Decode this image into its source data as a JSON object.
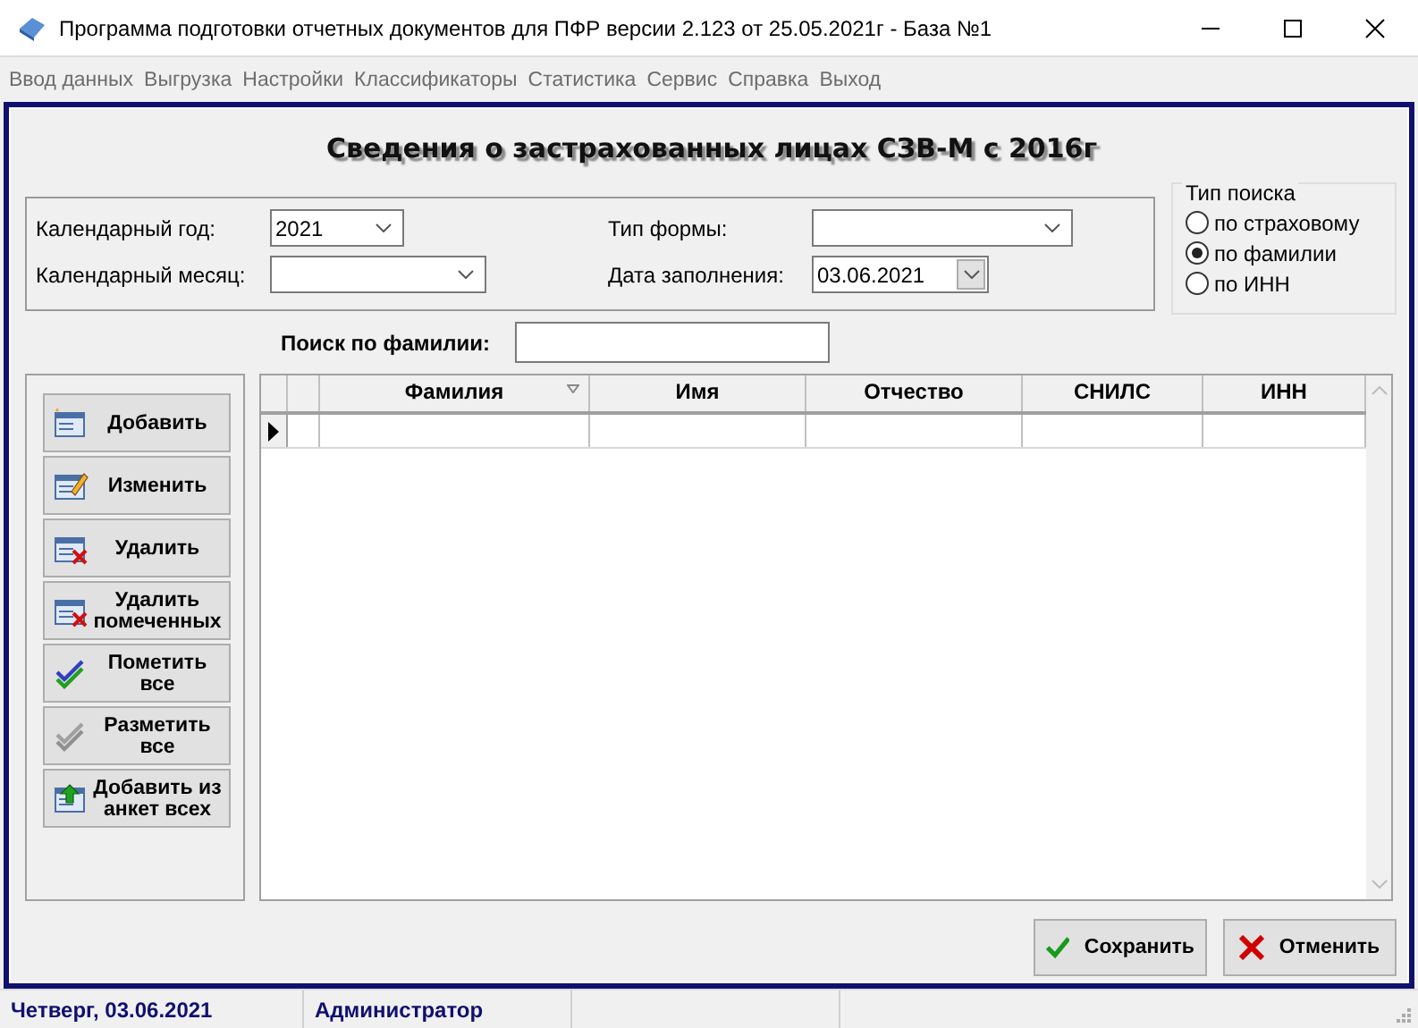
{
  "window": {
    "title": "Программа подготовки отчетных документов для ПФР версии 2.123 от 25.05.2021г - База №1"
  },
  "menu": [
    {
      "label": "Ввод данных",
      "disabled": true
    },
    {
      "label": "Выгрузка",
      "disabled": true
    },
    {
      "label": "Настройки",
      "disabled": true
    },
    {
      "label": "Классификаторы",
      "disabled": true
    },
    {
      "label": "Статистика",
      "disabled": true
    },
    {
      "label": "Сервис",
      "disabled": true
    },
    {
      "label": "Справка",
      "disabled": true
    },
    {
      "label": "Выход",
      "disabled": true
    }
  ],
  "form": {
    "title": "Сведения о застрахованных лицах СЗВ-М с 2016г",
    "fields": [
      {
        "label": "Календарный год:",
        "value": "2021",
        "kind": "combo"
      },
      {
        "label": "Календарный месяц:",
        "kind": "combo"
      },
      {
        "label": "Тип формы:",
        "kind": "combo"
      },
      {
        "label": "Дата заполнения:",
        "value": "03.06.2021",
        "kind": "date"
      }
    ],
    "search_type": {
      "title": "Тип поиска",
      "options": [
        {
          "label": "по страховому",
          "selected": false
        },
        {
          "label": "по фамилии",
          "selected": true
        },
        {
          "label": "по ИНН",
          "selected": false
        }
      ]
    },
    "search": {
      "label": "Поиск по фамилии:"
    },
    "side_buttons": [
      {
        "label": "Добавить",
        "kind": "add"
      },
      {
        "label": "Изменить",
        "kind": "edit"
      },
      {
        "label": "Удалить",
        "kind": "delete"
      },
      {
        "label": "Удалить помеченных",
        "kind": "delete"
      },
      {
        "label": "Пометить все",
        "kind": "mark"
      },
      {
        "label": "Разметить все",
        "kind": "unmark"
      },
      {
        "label": "Добавить из анкет всех",
        "kind": "import"
      }
    ],
    "table": {
      "columns": [
        {
          "label": "Фамилия",
          "sorted": true
        },
        {
          "label": "Имя",
          "sorted": false
        },
        {
          "label": "Отчество",
          "sorted": false
        },
        {
          "label": "СНИЛС",
          "sorted": false
        },
        {
          "label": "ИНН",
          "sorted": false
        }
      ],
      "rows": [
        {
          "current": true
        }
      ]
    },
    "buttons": [
      {
        "label": "Сохранить",
        "kind": "ok"
      },
      {
        "label": "Отменить",
        "kind": "cancel"
      }
    ]
  },
  "status_bar": [
    "Четверг, 03.06.2021",
    "Администратор"
  ]
}
